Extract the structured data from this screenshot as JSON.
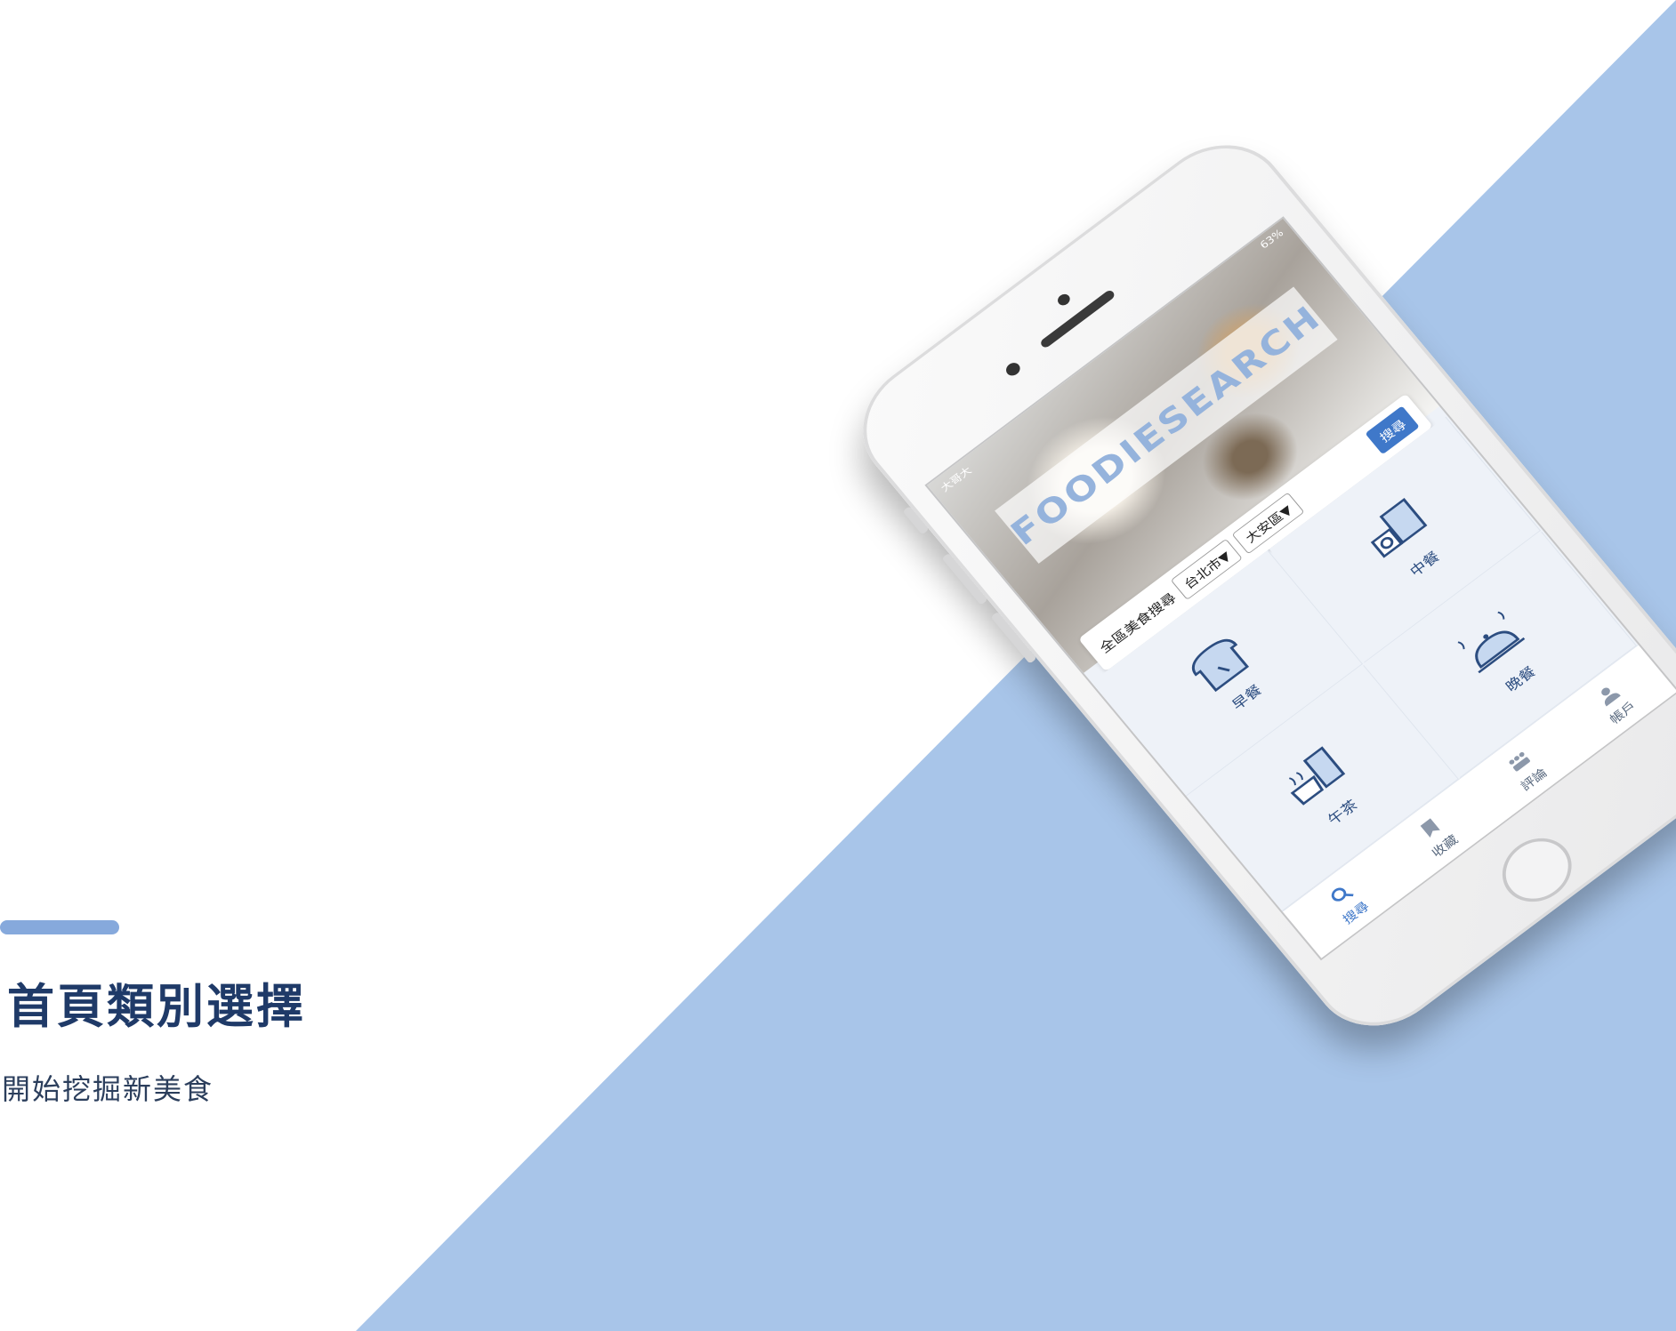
{
  "colors": {
    "accent": "#86a9dc",
    "stripe": "#a8c5e9",
    "title": "#1f3a68",
    "app_blue": "#3f78c9"
  },
  "caption": {
    "title": "首頁類別選擇",
    "subtitle": "開始挖掘新美食"
  },
  "app": {
    "status": {
      "carrier": "大哥大",
      "battery": "63%"
    },
    "logo": "FOODIESEARCH",
    "search": {
      "label": "全區美食搜尋",
      "city": "台北市▼",
      "district": "大安區▼",
      "button": "搜尋"
    },
    "categories": [
      {
        "label": "早餐",
        "icon": "bread-toast-icon"
      },
      {
        "label": "中餐",
        "icon": "lunch-set-icon"
      },
      {
        "label": "午茶",
        "icon": "tea-coffee-icon"
      },
      {
        "label": "晚餐",
        "icon": "dinner-cloche-icon"
      }
    ],
    "tabs": [
      {
        "label": "搜尋",
        "icon": "search-icon"
      },
      {
        "label": "收藏",
        "icon": "bookmark-icon"
      },
      {
        "label": "評論",
        "icon": "review-icon"
      },
      {
        "label": "帳戶",
        "icon": "user-icon"
      }
    ]
  }
}
